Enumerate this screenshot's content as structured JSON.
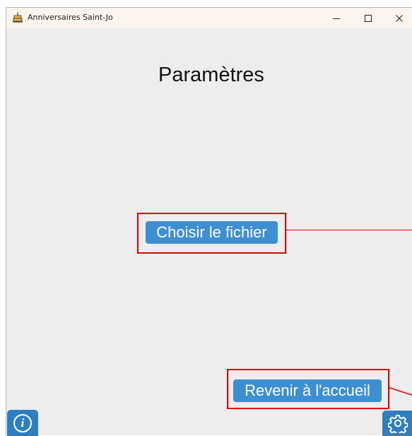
{
  "window": {
    "title": "Anniversaires Saint-Jo",
    "app_icon": "birthday-cake-icon",
    "controls": [
      "minimize-icon",
      "maximize-icon",
      "close-icon"
    ]
  },
  "main": {
    "heading": "Paramètres",
    "choose_file_label": "Choisir le fichier",
    "back_home_label": "Revenir à l'accueil"
  },
  "footer": {
    "info_icon": "info-icon",
    "settings_icon": "gear-icon"
  },
  "colors": {
    "accent": "#3d8fd1",
    "corner_buttons": "#2e7fc0",
    "highlight": "#e60000",
    "background": "#ededed",
    "titlebar": "#fbf4ec"
  }
}
